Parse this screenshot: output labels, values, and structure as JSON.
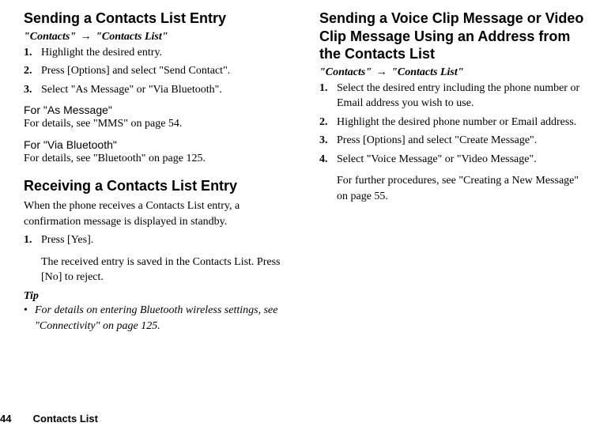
{
  "left": {
    "sending": {
      "heading": "Sending a Contacts List Entry",
      "breadcrumb": {
        "a": "\"Contacts\"",
        "arrow": "→",
        "b": "\"Contacts List\""
      },
      "steps": [
        "Highlight the desired entry.",
        "Press [Options] and select \"Send Contact\".",
        "Select \"As Message\" or \"Via Bluetooth\"."
      ],
      "asMessage": {
        "label": "For \"As Message\"",
        "detail": "For details, see \"MMS\" on page 54."
      },
      "viaBluetooth": {
        "label": "For \"Via Bluetooth\"",
        "detail": "For details, see \"Bluetooth\" on page 125."
      }
    },
    "receiving": {
      "heading": "Receiving a Contacts List Entry",
      "intro": "When the phone receives a Contacts List entry, a confirmation message is displayed in standby.",
      "steps": [
        "Press [Yes]."
      ],
      "note": "The received entry is saved in the Contacts List. Press [No] to reject.",
      "tipLabel": "Tip",
      "tipText": "For details on entering Bluetooth wireless settings, see \"Connectivity\" on page 125."
    }
  },
  "right": {
    "heading": "Sending a Voice Clip Message or Video Clip Message Using an Address from the Contacts List",
    "breadcrumb": {
      "a": "\"Contacts\"",
      "arrow": "→",
      "b": "\"Contacts List\""
    },
    "steps": [
      "Select the desired entry including the phone number or Email address you wish to use.",
      "Highlight the desired phone number or Email address.",
      "Press [Options] and select \"Create Message\".",
      "Select \"Voice Message\" or \"Video Message\"."
    ],
    "note": "For further procedures, see \"Creating a New Message\" on page 55."
  },
  "footer": {
    "page": "44",
    "section": "Contacts List"
  }
}
